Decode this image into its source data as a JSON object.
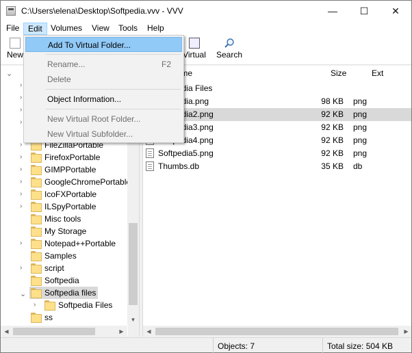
{
  "window": {
    "title": "C:\\Users\\elena\\Desktop\\Softpedia.vvv - VVV",
    "minimize_glyph": "—",
    "maximize_glyph": "☐",
    "close_glyph": "✕"
  },
  "menubar": {
    "items": [
      "File",
      "Edit",
      "Volumes",
      "View",
      "Tools",
      "Help"
    ]
  },
  "toolbar": {
    "new_label": "New",
    "virtual_label": "Virtual",
    "search_label": "Search"
  },
  "edit_menu": {
    "add_to_virtual_folder": "Add To Virtual Folder...",
    "rename": "Rename...",
    "rename_key": "F2",
    "delete": "Delete",
    "object_information": "Object Information...",
    "new_virtual_root_folder": "New Virtual Root Folder...",
    "new_virtual_subfolder": "New Virtual Subfolder..."
  },
  "tree": {
    "items": [
      {
        "label": "FileZillaPortable",
        "expandable": true
      },
      {
        "label": "FirefoxPortable",
        "expandable": true
      },
      {
        "label": "GIMPPortable",
        "expandable": true
      },
      {
        "label": "GoogleChromePortable",
        "expandable": true
      },
      {
        "label": "IcoFXPortable",
        "expandable": true
      },
      {
        "label": "ILSpyPortable",
        "expandable": true
      },
      {
        "label": "Misc tools",
        "expandable": false
      },
      {
        "label": "My Storage",
        "expandable": false
      },
      {
        "label": "Notepad++Portable",
        "expandable": true
      },
      {
        "label": "Samples",
        "expandable": false
      },
      {
        "label": "script",
        "expandable": true
      },
      {
        "label": "Softpedia",
        "expandable": false
      },
      {
        "label": "Softpedia files",
        "expandable": true
      },
      {
        "label": "Softpedia Files",
        "expandable": true
      },
      {
        "label": "ss",
        "expandable": false
      }
    ]
  },
  "file_list": {
    "headers": {
      "name": "Name",
      "size": "Size",
      "ext": "Ext"
    },
    "parent_folder": "Softpedia Files",
    "rows": [
      {
        "name": "Softpedia.png",
        "size": "98 KB",
        "ext": "png"
      },
      {
        "name": "Softpedia2.png",
        "size": "92 KB",
        "ext": "png"
      },
      {
        "name": "Softpedia3.png",
        "size": "92 KB",
        "ext": "png"
      },
      {
        "name": "Softpedia4.png",
        "size": "92 KB",
        "ext": "png"
      },
      {
        "name": "Softpedia5.png",
        "size": "92 KB",
        "ext": "png"
      },
      {
        "name": "Thumbs.db",
        "size": "35 KB",
        "ext": "db"
      }
    ]
  },
  "statusbar": {
    "objects": "Objects: 7",
    "total_size": "Total size: 504 KB"
  },
  "colors": {
    "menu_highlight": "#91c9f7",
    "selection": "#d9d9d9",
    "folder": "#ffe08a"
  }
}
